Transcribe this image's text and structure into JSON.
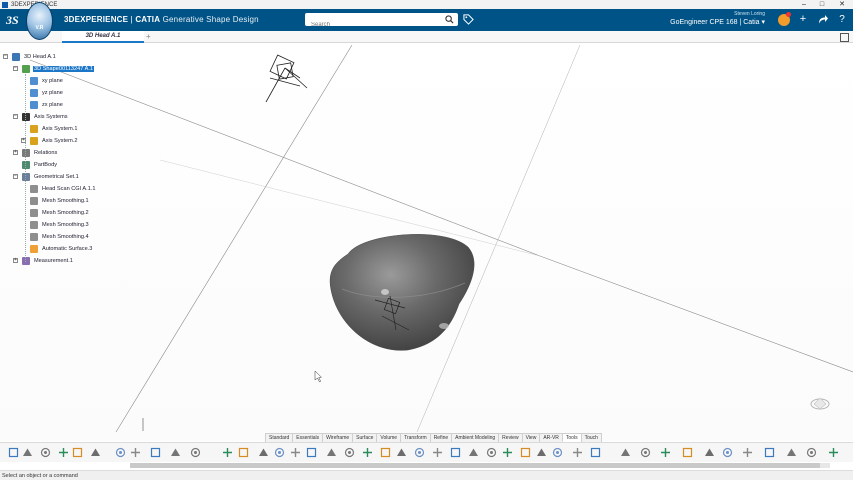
{
  "window": {
    "title": "3DEXPERIENCE",
    "controls": [
      "–",
      "□",
      "✕"
    ]
  },
  "topbar": {
    "brand_bold": "3DEXPERIENCE",
    "brand_sep": " | ",
    "brand_app": "CATIA",
    "brand_role": " Generative Shape Design",
    "compass_version": "V.R",
    "search_placeholder": "Search",
    "user_small": "Steven Loring",
    "user_name": "GoEngineer CPE 168 | Catia ▾",
    "icons": [
      "tag-icon",
      "add-icon",
      "share-icon",
      "help-icon"
    ]
  },
  "tabs": [
    {
      "label": "3D Head A.1"
    }
  ],
  "tab_add": "+",
  "tree": {
    "items": [
      {
        "label": "3D Head A.1",
        "icon": "product-icon",
        "name": "tree-root"
      },
      {
        "label": "3D Shape00113247 A.1",
        "icon": "shape-icon",
        "name": "tree-shape",
        "selected": true
      },
      {
        "label": "xy plane",
        "icon": "plane-icon",
        "name": "tree-xy-plane"
      },
      {
        "label": "yz plane",
        "icon": "plane-icon",
        "name": "tree-yz-plane"
      },
      {
        "label": "zx plane",
        "icon": "plane-icon",
        "name": "tree-zx-plane"
      },
      {
        "label": "Axis Systems",
        "icon": "axis-systems-icon",
        "name": "tree-axis-systems"
      },
      {
        "label": "Axis System.1",
        "icon": "axis-icon",
        "name": "tree-axis-system-1"
      },
      {
        "label": "Axis System.2",
        "icon": "axis-icon",
        "name": "tree-axis-system-2"
      },
      {
        "label": "Relations",
        "icon": "relations-icon",
        "name": "tree-relations"
      },
      {
        "label": "PartBody",
        "icon": "body-icon",
        "name": "tree-partbody"
      },
      {
        "label": "Geometrical Set.1",
        "icon": "geoset-icon",
        "name": "tree-geometrical-set"
      },
      {
        "label": "Head Scan CGI A.1.1",
        "icon": "mesh-icon",
        "name": "tree-head-scan"
      },
      {
        "label": "Mesh Smoothing.1",
        "icon": "mesh-icon",
        "name": "tree-mesh-smoothing-1"
      },
      {
        "label": "Mesh Smoothing.2",
        "icon": "mesh-icon",
        "name": "tree-mesh-smoothing-2"
      },
      {
        "label": "Mesh Smoothing.3",
        "icon": "mesh-icon",
        "name": "tree-mesh-smoothing-3"
      },
      {
        "label": "Mesh Smoothing.4",
        "icon": "mesh-icon",
        "name": "tree-mesh-smoothing-4"
      },
      {
        "label": "Automatic Surface.3",
        "icon": "surface-icon",
        "name": "tree-automatic-surface"
      },
      {
        "label": "Measurement.1",
        "icon": "measure-icon",
        "name": "tree-measurement"
      }
    ]
  },
  "sections": [
    "Standard",
    "Essentials",
    "Wireframe",
    "Surface",
    "Volume",
    "Transform",
    "Refine",
    "Ambient Modeling",
    "Review",
    "View",
    "AR-VR",
    "Tools",
    "Touch"
  ],
  "active_section": "Tools",
  "status_text": "Select an object or a command",
  "colors": {
    "brand_blue": "#005386",
    "selection": "#1d77c8",
    "shape_gray": "#5b5b5b"
  }
}
